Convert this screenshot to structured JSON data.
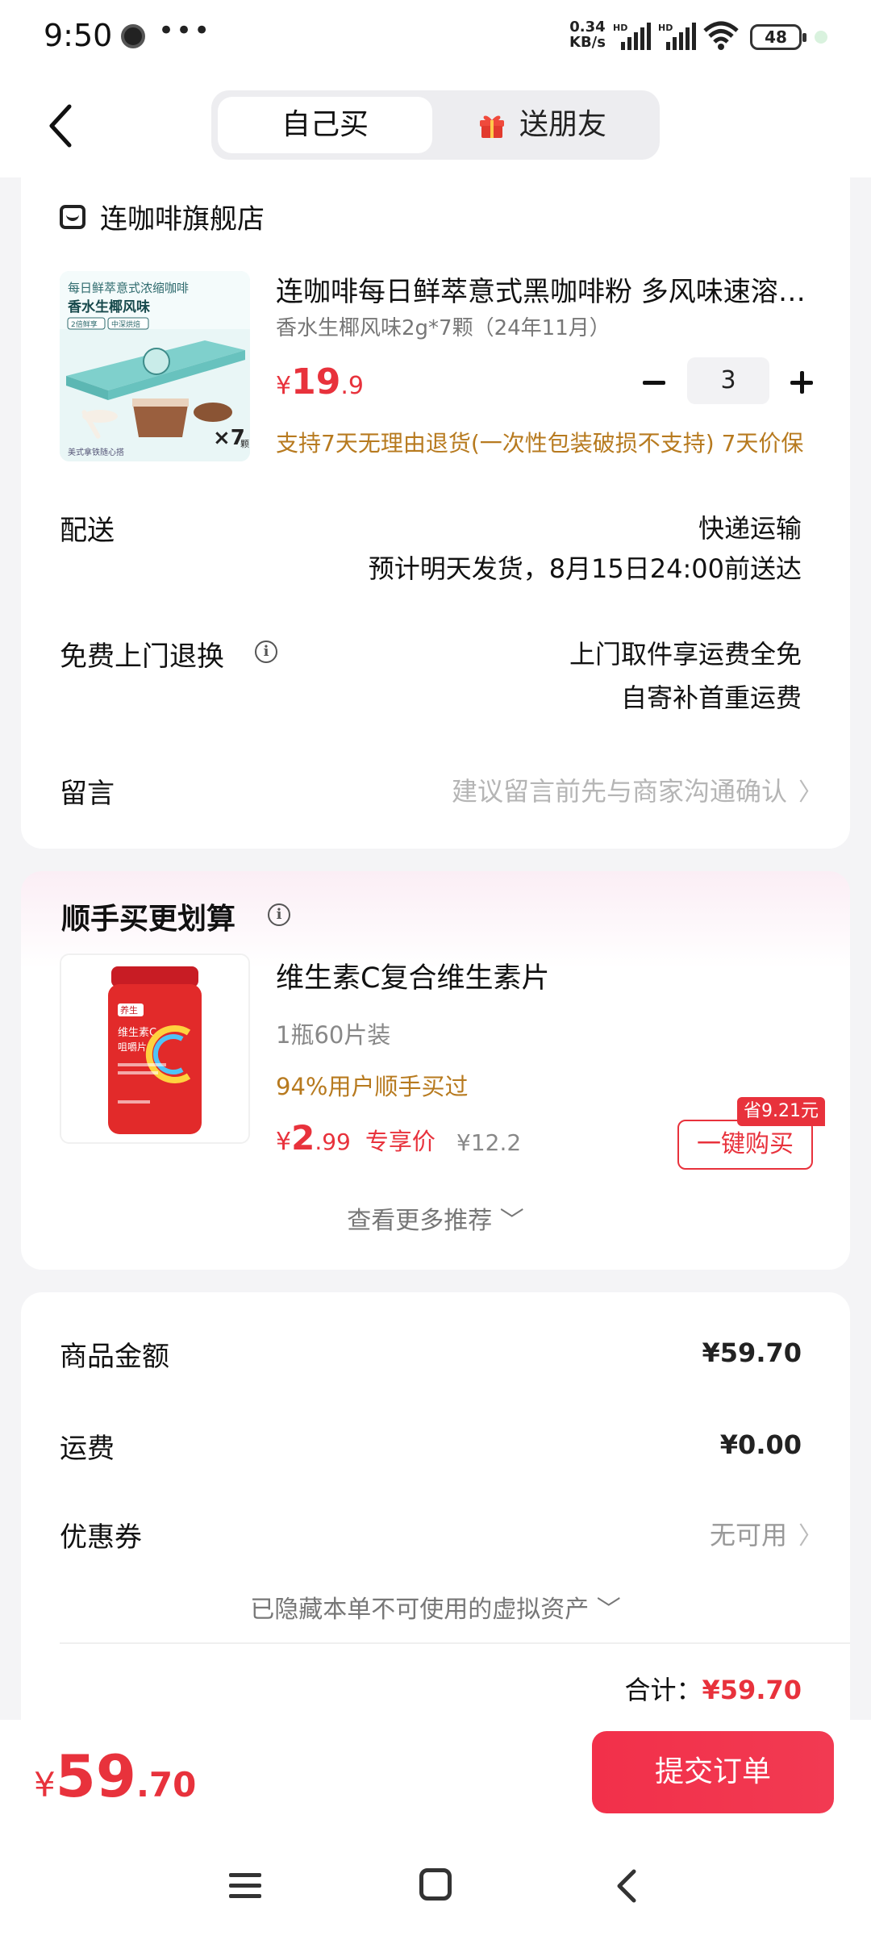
{
  "status_bar": {
    "time": "9:50",
    "dots": "•••",
    "net_speed_value": "0.34",
    "net_speed_unit": "KB/s",
    "hd1": "HD",
    "hd2": "HD",
    "battery": "48"
  },
  "header": {
    "tab_self": "自己买",
    "tab_gift": "送朋友"
  },
  "store": {
    "name": "连咖啡旗舰店"
  },
  "product": {
    "title": "连咖啡每日鲜萃意式黑咖啡粉 多风味速溶咖啡",
    "spec": "香水生椰风味2g*7颗（24年11月）",
    "price_currency": "¥",
    "price_int": "19",
    "price_dec": ".9",
    "quantity": "3",
    "service": "支持7天无理由退货(一次性包装破损不支持) 7天价保",
    "image_text": {
      "line1": "每日鲜萃意式浓缩咖啡",
      "line2": "香水生椰风味",
      "badge_left": "2倍鲜享",
      "badge_right": "中深烘焙",
      "count": "×7",
      "count_unit": "颗",
      "footer": "美式拿铁随心搭"
    }
  },
  "delivery": {
    "label": "配送",
    "method": "快递运输",
    "eta": "预计明天发货，8月15日24:00前送达"
  },
  "return_service": {
    "label": "免费上门退换",
    "line1": "上门取件享运费全免",
    "line2": "自寄补首重运费"
  },
  "message": {
    "label": "留言",
    "placeholder": "建议留言前先与商家沟通确认"
  },
  "recommend": {
    "title": "顺手买更划算",
    "name": "维生素C复合维生素片",
    "spec": "1瓶60片装",
    "social": "94%用户顺手买过",
    "price_currency": "¥",
    "price_int": "2",
    "price_dec": ".99",
    "price_tag": "专享价",
    "original_price": "¥12.2",
    "save_badge": "省9.21元",
    "buy_button": "一键购买",
    "more": "查看更多推荐",
    "image_text": {
      "brand": "养生",
      "line1": "维生素C",
      "line2": "咀嚼片"
    }
  },
  "summary": {
    "goods_label": "商品金额",
    "goods_value": "¥59.70",
    "shipping_label": "运费",
    "shipping_value": "¥0.00",
    "coupon_label": "优惠券",
    "coupon_value": "无可用",
    "hidden_assets": "已隐藏本单不可使用的虚拟资产",
    "total_label": "合计：",
    "total_value": "¥59.70"
  },
  "bottom_bar": {
    "price_currency": "¥",
    "price_int": "59",
    "price_dec": ".70",
    "submit": "提交订单"
  },
  "colors": {
    "accent": "#e8323c",
    "service_text": "#b77a1f",
    "page_bg": "#f4f4f6"
  },
  "icons": [
    "clock-icon",
    "signal-icon",
    "wifi-icon",
    "battery-icon",
    "back-arrow-icon",
    "gift-icon",
    "store-icon",
    "minus-icon",
    "plus-icon",
    "info-icon",
    "chevron-right-icon",
    "chevron-down-icon",
    "nav-menu-icon",
    "nav-home-icon",
    "nav-back-icon"
  ]
}
